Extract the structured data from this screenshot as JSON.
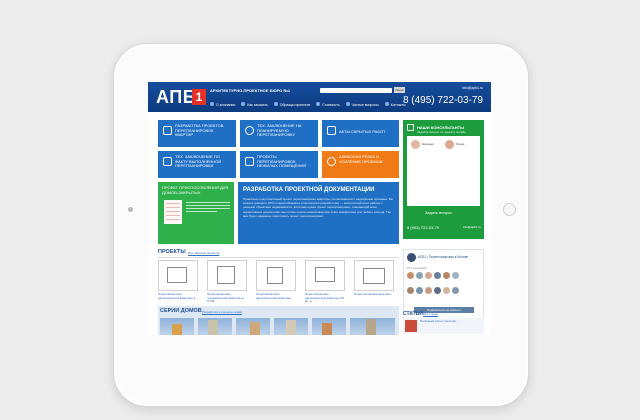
{
  "header": {
    "logo_text": "АПБ",
    "logo_number": "1",
    "tagline": "АРХИТЕКТУРНО-ПРОЕКТНОЕ БЮРО №1",
    "search_button": "Поиск",
    "email": "info@apb1.ru",
    "phone": "8 (495) 722-03-79",
    "nav": [
      "О компании",
      "Как заказать",
      "Образцы проектов",
      "Стоимость",
      "Частые вопросы",
      "Контакты"
    ]
  },
  "tiles": [
    {
      "label": "РАЗРАБОТКА ПРОЕКТОВ ПЕРЕПЛАНИРОВОК КВАРТИР"
    },
    {
      "label": "ТЕХ. ЗАКЛЮЧЕНИЕ НА ПЛАНИРУЕМУЮ ПЕРЕПЛАНИРОВКУ"
    },
    {
      "label": "АКТЫ СКРЫТЫХ РАБОТ"
    },
    {
      "label": "ТЕХ. ЗАКЛЮЧЕНИЕ ПО ФАКТУ ВЫПОЛНЕННОЙ ПЕРЕПЛАНИРОВКИ"
    },
    {
      "label": "ПРОЕКТЫ ПЕРЕПЛАНИРОВОК НЕЖИЛЫХ ПОМЕЩЕНИЙ"
    },
    {
      "label": "АЛМАЗНАЯ РЕЗКА И УСИЛЕНИЕ ПРОЕМОВ"
    }
  ],
  "consult": {
    "title": "НАШИ КОНСУЛЬТАНТЫ",
    "subtitle": "Задайте вопрос по проекту онлайн",
    "consultants": [
      "Наталья",
      "Ольга"
    ],
    "ask_button": "Задать вопрос",
    "phone": "8 (963) 722-03-79",
    "email": "info@apb1.ru"
  },
  "project_card": {
    "title": "ПРОЕКТ ПРИСПОСОБЛЕНИЯ ДЛЯ ДОМОВ-ЗАКРЫТЫХ"
  },
  "development": {
    "title": "РАЗРАБОТКА ПРОЕКТНОЙ ДОКУМЕНТАЦИИ",
    "body": "Правильно подготовленный проект перепланировки квартиры, согласованный с надзорными органами. Вы можете доверить СРО и гарантийными в этом вопросе разработчику — многолетний опыт работы с разными объектами недвижимости. Если вам нужен проект перепланировки, отвечающий всем нормативным документам, мы готовы помочь вашей квартире стать комфортнее для любого жильца. Так вам будет надежнее подготовить проект перепланировки."
  },
  "projects": {
    "title": "ПРОЕКТЫ",
    "link": "Все образцы проектов",
    "items": [
      "Перепланировка двухкомнатной квартиры в ...",
      "Перепланировка трехкомнатной квартиры в П-3М",
      "Перепланировка двухкомнатной квартиры",
      "Перепланировка двухкомнатной квартиры 55 кв. м",
      "Перепланировка квартиры"
    ]
  },
  "vk": {
    "title": "АПБ1 | Перепланировка в Москве",
    "members": "87 участников",
    "subscribe": "Подписаться на новости"
  },
  "series": {
    "title": "СЕРИИ ДОМОВ",
    "link": "Разработка и проекты серий"
  },
  "articles": {
    "title": "СТАТЬИ",
    "link": "Все статьи",
    "item": "Полезный план с желтым ..."
  },
  "colors": {
    "header_blue": "#154d9c",
    "tile_blue": "#1f6fc4",
    "tile_green": "#2fb04a",
    "tile_orange": "#f07a16",
    "logo_red": "#e4322b"
  }
}
